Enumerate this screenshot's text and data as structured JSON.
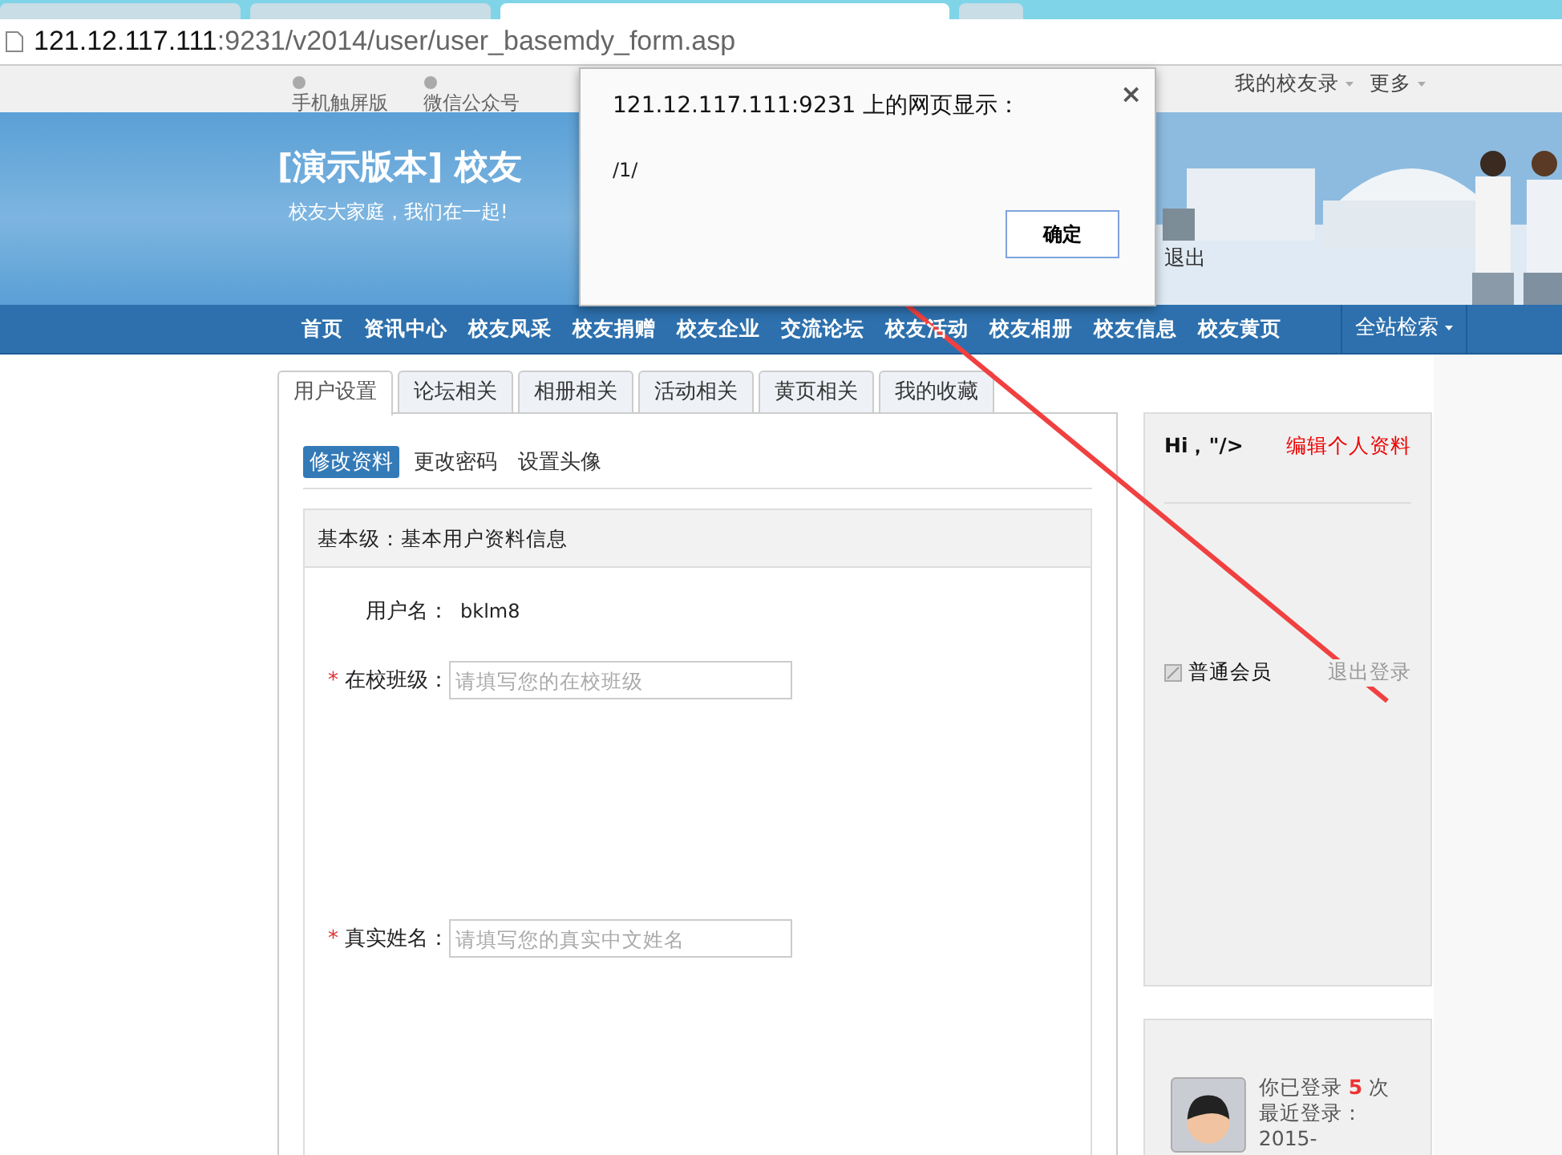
{
  "browser": {
    "tabs": [
      {
        "selected": false
      },
      {
        "selected": false
      },
      {
        "selected": true
      },
      {
        "selected": false
      }
    ],
    "address": {
      "host": "121.12.117.111",
      "path": ":9231/v2014/user/user_basemdy_form.asp"
    }
  },
  "topbar": {
    "left_links": [
      "手机触屏版",
      "微信公众号"
    ],
    "right_links": [
      "我的校友录",
      "更多"
    ]
  },
  "banner": {
    "title": "[演示版本] 校友",
    "slogan": "校友大家庭，我们在一起!",
    "logout": "退出"
  },
  "nav": {
    "items": [
      "首页",
      "资讯中心",
      "校友风采",
      "校友捐赠",
      "校友企业",
      "交流论坛",
      "校友活动",
      "校友相册",
      "校友信息",
      "校友黄页"
    ],
    "search": "全站检索"
  },
  "tabs": [
    {
      "label": "用户设置",
      "selected": true
    },
    {
      "label": "论坛相关",
      "selected": false
    },
    {
      "label": "相册相关",
      "selected": false
    },
    {
      "label": "活动相关",
      "selected": false
    },
    {
      "label": "黄页相关",
      "selected": false
    },
    {
      "label": "我的收藏",
      "selected": false
    }
  ],
  "subtabs": [
    {
      "label": "修改资料",
      "selected": true
    },
    {
      "label": "更改密码",
      "selected": false
    },
    {
      "label": "设置头像",
      "selected": false
    }
  ],
  "section": {
    "title": "基本级：基本用户资料信息",
    "required_mark": "*",
    "fields": [
      {
        "kind": "static",
        "label": "用户名：",
        "value": "bklm8",
        "required": false
      },
      {
        "kind": "input",
        "label": "在校班级：",
        "placeholder": "请填写您的在校班级",
        "required": true
      },
      {
        "kind": "input",
        "label": "真实姓名：",
        "placeholder": "请填写您的真实中文姓名",
        "required": true
      }
    ]
  },
  "sidebar": {
    "greeting": "Hi，\"/>",
    "edit_link": "编辑个人资料",
    "member_level": "普通会员",
    "logout_link": "退出登录",
    "login_count_prefix": "你已登录",
    "login_count": "5",
    "login_count_suffix": "次",
    "last_login": "最近登录：2015-"
  },
  "dialog": {
    "title": "121.12.117.111:9231 上的网页显示：",
    "message": "/1/",
    "ok": "确定",
    "close": "×"
  }
}
